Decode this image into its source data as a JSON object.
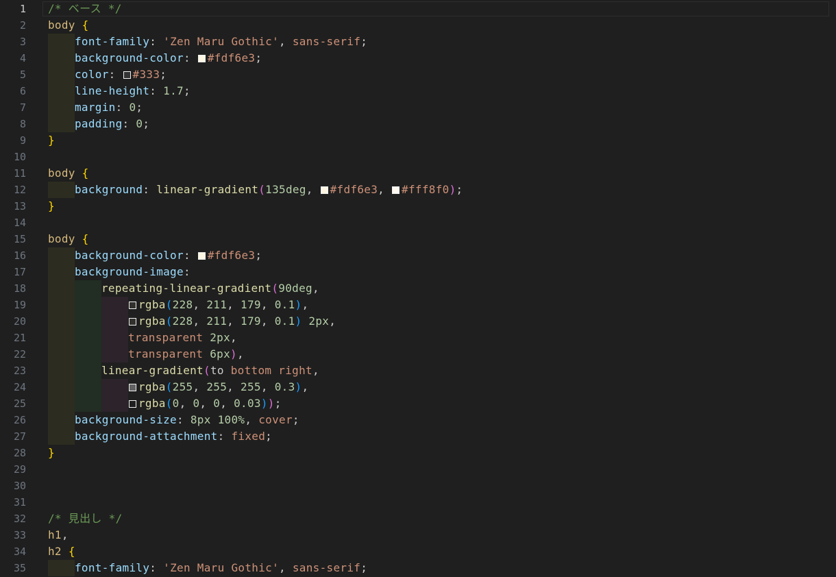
{
  "editor": {
    "language": "css",
    "active_line": 1,
    "colors": {
      "background": "#1f1f1f",
      "comment": "#6a9955",
      "selector": "#d7ba7d",
      "brace": "#ffd700",
      "property": "#9cdcfe",
      "string": "#ce9178",
      "number": "#b5cea8",
      "function": "#dcdcaa"
    },
    "lines": [
      {
        "n": "1",
        "indent": 0,
        "tokens": [
          {
            "t": "/* ベース */",
            "c": "comment"
          }
        ]
      },
      {
        "n": "2",
        "indent": 0,
        "tokens": [
          {
            "t": "body",
            "c": "sel"
          },
          {
            "t": " ",
            "c": "punct"
          },
          {
            "t": "{",
            "c": "brace"
          }
        ]
      },
      {
        "n": "3",
        "indent": 1,
        "tokens": [
          {
            "t": "font-family",
            "c": "prop"
          },
          {
            "t": ": ",
            "c": "punct"
          },
          {
            "t": "'Zen Maru Gothic'",
            "c": "str"
          },
          {
            "t": ", ",
            "c": "punct"
          },
          {
            "t": "sans-serif",
            "c": "kw"
          },
          {
            "t": ";",
            "c": "punct"
          }
        ]
      },
      {
        "n": "4",
        "indent": 1,
        "tokens": [
          {
            "t": "background-color",
            "c": "prop"
          },
          {
            "t": ": ",
            "c": "punct"
          },
          {
            "sw": "#fdf6e3"
          },
          {
            "t": "#fdf6e3",
            "c": "str"
          },
          {
            "t": ";",
            "c": "punct"
          }
        ]
      },
      {
        "n": "5",
        "indent": 1,
        "tokens": [
          {
            "t": "color",
            "c": "prop"
          },
          {
            "t": ": ",
            "c": "punct"
          },
          {
            "sw": "#333333"
          },
          {
            "t": "#333",
            "c": "str"
          },
          {
            "t": ";",
            "c": "punct"
          }
        ]
      },
      {
        "n": "6",
        "indent": 1,
        "tokens": [
          {
            "t": "line-height",
            "c": "prop"
          },
          {
            "t": ": ",
            "c": "punct"
          },
          {
            "t": "1.7",
            "c": "num"
          },
          {
            "t": ";",
            "c": "punct"
          }
        ]
      },
      {
        "n": "7",
        "indent": 1,
        "tokens": [
          {
            "t": "margin",
            "c": "prop"
          },
          {
            "t": ": ",
            "c": "punct"
          },
          {
            "t": "0",
            "c": "num"
          },
          {
            "t": ";",
            "c": "punct"
          }
        ]
      },
      {
        "n": "8",
        "indent": 1,
        "tokens": [
          {
            "t": "padding",
            "c": "prop"
          },
          {
            "t": ": ",
            "c": "punct"
          },
          {
            "t": "0",
            "c": "num"
          },
          {
            "t": ";",
            "c": "punct"
          }
        ]
      },
      {
        "n": "9",
        "indent": 0,
        "tokens": [
          {
            "t": "}",
            "c": "brace"
          }
        ]
      },
      {
        "n": "10",
        "indent": 0,
        "tokens": []
      },
      {
        "n": "11",
        "indent": 0,
        "tokens": [
          {
            "t": "body",
            "c": "sel"
          },
          {
            "t": " ",
            "c": "punct"
          },
          {
            "t": "{",
            "c": "brace"
          }
        ]
      },
      {
        "n": "12",
        "indent": 1,
        "tokens": [
          {
            "t": "background",
            "c": "prop"
          },
          {
            "t": ": ",
            "c": "punct"
          },
          {
            "t": "linear-gradient",
            "c": "func"
          },
          {
            "t": "(",
            "c": "paren"
          },
          {
            "t": "135deg",
            "c": "num"
          },
          {
            "t": ", ",
            "c": "punct"
          },
          {
            "sw": "#fdf6e3"
          },
          {
            "t": "#fdf6e3",
            "c": "str"
          },
          {
            "t": ", ",
            "c": "punct"
          },
          {
            "sw": "#fff8f0"
          },
          {
            "t": "#fff8f0",
            "c": "str"
          },
          {
            "t": ")",
            "c": "paren"
          },
          {
            "t": ";",
            "c": "punct"
          }
        ]
      },
      {
        "n": "13",
        "indent": 0,
        "tokens": [
          {
            "t": "}",
            "c": "brace"
          }
        ]
      },
      {
        "n": "14",
        "indent": 0,
        "tokens": []
      },
      {
        "n": "15",
        "indent": 0,
        "tokens": [
          {
            "t": "body",
            "c": "sel"
          },
          {
            "t": " ",
            "c": "punct"
          },
          {
            "t": "{",
            "c": "brace"
          }
        ]
      },
      {
        "n": "16",
        "indent": 1,
        "tokens": [
          {
            "t": "background-color",
            "c": "prop"
          },
          {
            "t": ": ",
            "c": "punct"
          },
          {
            "sw": "#fdf6e3"
          },
          {
            "t": "#fdf6e3",
            "c": "str"
          },
          {
            "t": ";",
            "c": "punct"
          }
        ]
      },
      {
        "n": "17",
        "indent": 1,
        "tokens": [
          {
            "t": "background-image",
            "c": "prop"
          },
          {
            "t": ":",
            "c": "punct"
          }
        ]
      },
      {
        "n": "18",
        "indent": 2,
        "tokens": [
          {
            "t": "repeating-linear-gradient",
            "c": "func"
          },
          {
            "t": "(",
            "c": "paren"
          },
          {
            "t": "90deg",
            "c": "num"
          },
          {
            "t": ",",
            "c": "punct"
          }
        ]
      },
      {
        "n": "19",
        "indent": 3,
        "tokens": [
          {
            "sw": "rgba(228,211,179,0.1)"
          },
          {
            "t": "rgba",
            "c": "func"
          },
          {
            "t": "(",
            "c": "paren2"
          },
          {
            "t": "228",
            "c": "num"
          },
          {
            "t": ", ",
            "c": "punct"
          },
          {
            "t": "211",
            "c": "num"
          },
          {
            "t": ", ",
            "c": "punct"
          },
          {
            "t": "179",
            "c": "num"
          },
          {
            "t": ", ",
            "c": "punct"
          },
          {
            "t": "0.1",
            "c": "num"
          },
          {
            "t": ")",
            "c": "paren2"
          },
          {
            "t": ",",
            "c": "punct"
          }
        ]
      },
      {
        "n": "20",
        "indent": 3,
        "tokens": [
          {
            "sw": "rgba(228,211,179,0.1)"
          },
          {
            "t": "rgba",
            "c": "func"
          },
          {
            "t": "(",
            "c": "paren2"
          },
          {
            "t": "228",
            "c": "num"
          },
          {
            "t": ", ",
            "c": "punct"
          },
          {
            "t": "211",
            "c": "num"
          },
          {
            "t": ", ",
            "c": "punct"
          },
          {
            "t": "179",
            "c": "num"
          },
          {
            "t": ", ",
            "c": "punct"
          },
          {
            "t": "0.1",
            "c": "num"
          },
          {
            "t": ")",
            "c": "paren2"
          },
          {
            "t": " ",
            "c": "punct"
          },
          {
            "t": "2px",
            "c": "num"
          },
          {
            "t": ",",
            "c": "punct"
          }
        ]
      },
      {
        "n": "21",
        "indent": 3,
        "tokens": [
          {
            "t": "transparent",
            "c": "kw"
          },
          {
            "t": " ",
            "c": "punct"
          },
          {
            "t": "2px",
            "c": "num"
          },
          {
            "t": ",",
            "c": "punct"
          }
        ]
      },
      {
        "n": "22",
        "indent": 3,
        "tokens": [
          {
            "t": "transparent",
            "c": "kw"
          },
          {
            "t": " ",
            "c": "punct"
          },
          {
            "t": "6px",
            "c": "num"
          },
          {
            "t": ")",
            "c": "paren"
          },
          {
            "t": ",",
            "c": "punct"
          }
        ]
      },
      {
        "n": "23",
        "indent": 2,
        "tokens": [
          {
            "t": "linear-gradient",
            "c": "func"
          },
          {
            "t": "(",
            "c": "paren"
          },
          {
            "t": "to",
            "c": "punct"
          },
          {
            "t": " ",
            "c": "punct"
          },
          {
            "t": "bottom right",
            "c": "kw"
          },
          {
            "t": ",",
            "c": "punct"
          }
        ]
      },
      {
        "n": "24",
        "indent": 3,
        "tokens": [
          {
            "sw": "rgba(255,255,255,0.3)"
          },
          {
            "t": "rgba",
            "c": "func"
          },
          {
            "t": "(",
            "c": "paren2"
          },
          {
            "t": "255",
            "c": "num"
          },
          {
            "t": ", ",
            "c": "punct"
          },
          {
            "t": "255",
            "c": "num"
          },
          {
            "t": ", ",
            "c": "punct"
          },
          {
            "t": "255",
            "c": "num"
          },
          {
            "t": ", ",
            "c": "punct"
          },
          {
            "t": "0.3",
            "c": "num"
          },
          {
            "t": ")",
            "c": "paren2"
          },
          {
            "t": ",",
            "c": "punct"
          }
        ]
      },
      {
        "n": "25",
        "indent": 3,
        "tokens": [
          {
            "sw": "rgba(0,0,0,0.03)"
          },
          {
            "t": "rgba",
            "c": "func"
          },
          {
            "t": "(",
            "c": "paren2"
          },
          {
            "t": "0",
            "c": "num"
          },
          {
            "t": ", ",
            "c": "punct"
          },
          {
            "t": "0",
            "c": "num"
          },
          {
            "t": ", ",
            "c": "punct"
          },
          {
            "t": "0",
            "c": "num"
          },
          {
            "t": ", ",
            "c": "punct"
          },
          {
            "t": "0.03",
            "c": "num"
          },
          {
            "t": ")",
            "c": "paren2"
          },
          {
            "t": ")",
            "c": "paren"
          },
          {
            "t": ";",
            "c": "punct"
          }
        ]
      },
      {
        "n": "26",
        "indent": 1,
        "tokens": [
          {
            "t": "background-size",
            "c": "prop"
          },
          {
            "t": ": ",
            "c": "punct"
          },
          {
            "t": "8px",
            "c": "num"
          },
          {
            "t": " ",
            "c": "punct"
          },
          {
            "t": "100%",
            "c": "num"
          },
          {
            "t": ", ",
            "c": "punct"
          },
          {
            "t": "cover",
            "c": "kw"
          },
          {
            "t": ";",
            "c": "punct"
          }
        ]
      },
      {
        "n": "27",
        "indent": 1,
        "tokens": [
          {
            "t": "background-attachment",
            "c": "prop"
          },
          {
            "t": ": ",
            "c": "punct"
          },
          {
            "t": "fixed",
            "c": "kw"
          },
          {
            "t": ";",
            "c": "punct"
          }
        ]
      },
      {
        "n": "28",
        "indent": 0,
        "tokens": [
          {
            "t": "}",
            "c": "brace"
          }
        ]
      },
      {
        "n": "29",
        "indent": 0,
        "tokens": []
      },
      {
        "n": "30",
        "indent": 0,
        "tokens": []
      },
      {
        "n": "31",
        "indent": 0,
        "tokens": []
      },
      {
        "n": "32",
        "indent": 0,
        "tokens": [
          {
            "t": "/* 見出し */",
            "c": "comment"
          }
        ]
      },
      {
        "n": "33",
        "indent": 0,
        "tokens": [
          {
            "t": "h1",
            "c": "sel"
          },
          {
            "t": ",",
            "c": "punct"
          }
        ]
      },
      {
        "n": "34",
        "indent": 0,
        "tokens": [
          {
            "t": "h2",
            "c": "sel"
          },
          {
            "t": " ",
            "c": "punct"
          },
          {
            "t": "{",
            "c": "brace"
          }
        ]
      },
      {
        "n": "35",
        "indent": 1,
        "tokens": [
          {
            "t": "font-family",
            "c": "prop"
          },
          {
            "t": ": ",
            "c": "punct"
          },
          {
            "t": "'Zen Maru Gothic'",
            "c": "str"
          },
          {
            "t": ", ",
            "c": "punct"
          },
          {
            "t": "sans-serif",
            "c": "kw"
          },
          {
            "t": ";",
            "c": "punct"
          }
        ]
      }
    ]
  }
}
